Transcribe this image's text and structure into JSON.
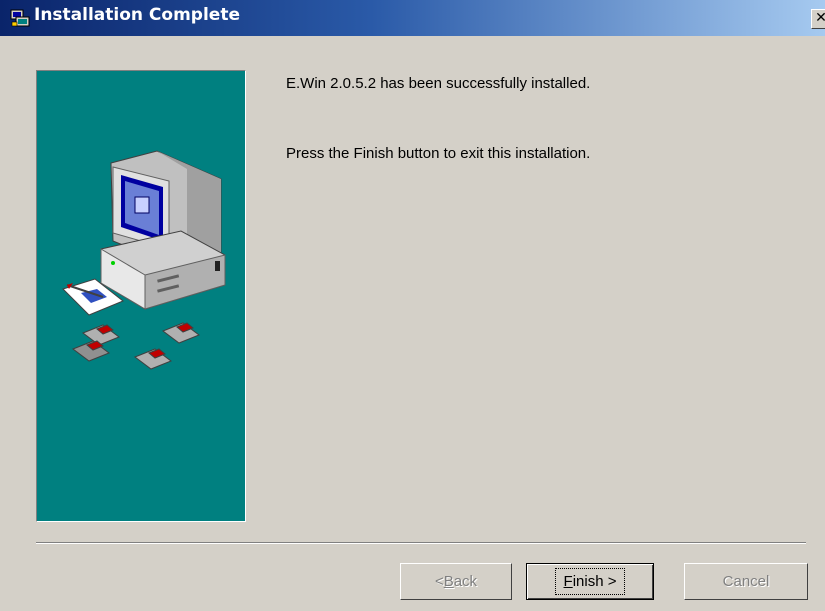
{
  "window": {
    "title": "Installation Complete",
    "close_glyph": "✕",
    "title_icon": "installer-icon"
  },
  "sidebar": {
    "illustration": "computer-with-disks-illustration",
    "background_color": "#008080"
  },
  "content": {
    "message_success": "E.Win 2.0.5.2 has been successfully installed.",
    "message_instruction": "Press the Finish button to exit this installation."
  },
  "buttons": {
    "back": {
      "prefix": "< ",
      "mnemonic": "B",
      "rest": "ack",
      "enabled": false
    },
    "finish": {
      "mnemonic": "F",
      "rest": "inish >",
      "enabled": true,
      "focused": true
    },
    "cancel": {
      "label": "Cancel",
      "enabled": false
    }
  }
}
